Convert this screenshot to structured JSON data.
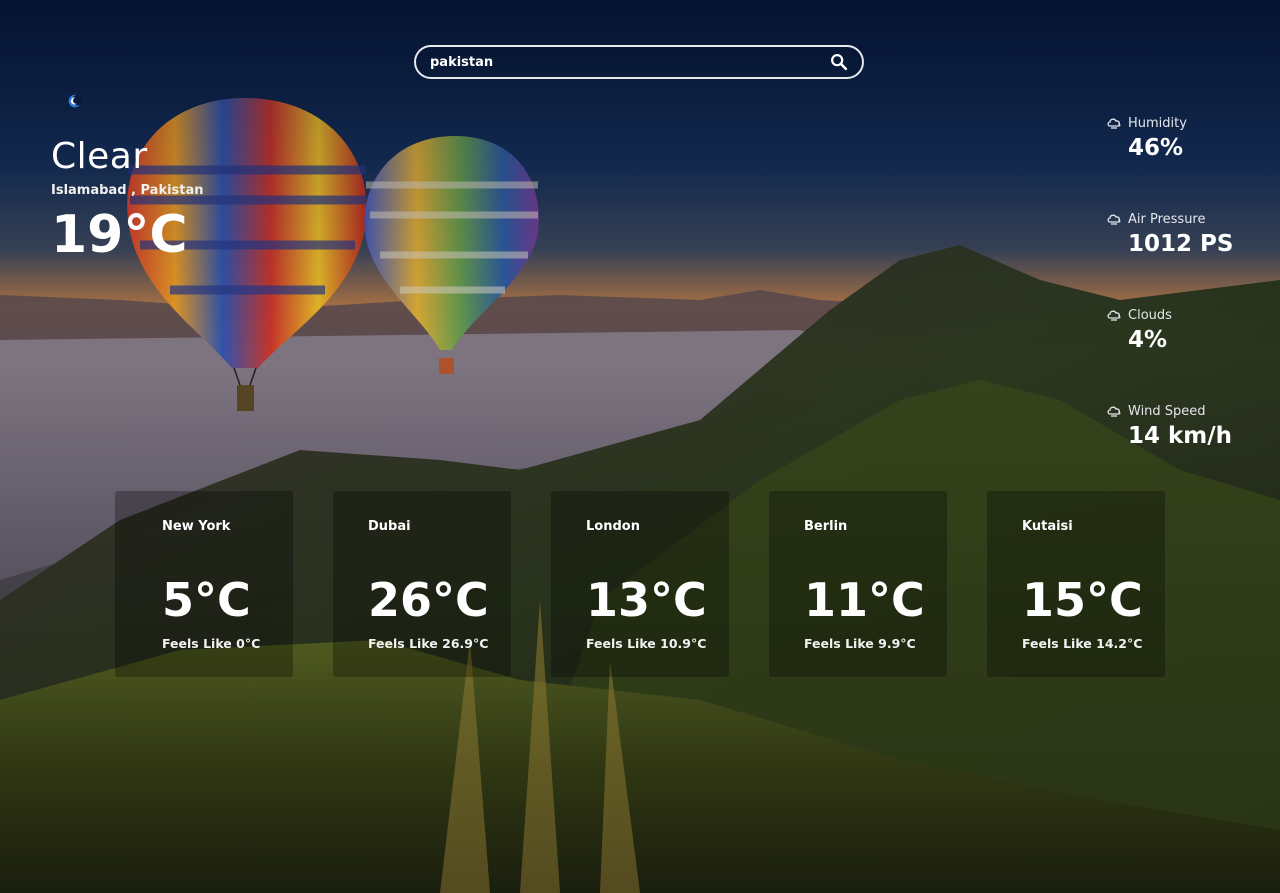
{
  "search": {
    "value": "pakistan"
  },
  "current": {
    "condition": "Clear",
    "location": "Islamabad , Pakistan",
    "temperature": "19°C"
  },
  "stats": [
    {
      "label": "Humidity",
      "value": "46%",
      "icon": "cloud-icon"
    },
    {
      "label": "Air Pressure",
      "value": "1012 PS",
      "icon": "cloud-icon"
    },
    {
      "label": "Clouds",
      "value": "4%",
      "icon": "cloud-icon"
    },
    {
      "label": "Wind Speed",
      "value": "14 km/h",
      "icon": "cloud-icon"
    }
  ],
  "cities": [
    {
      "name": "New York",
      "temp": "5°C",
      "feels": "Feels Like 0°C"
    },
    {
      "name": "Dubai",
      "temp": "26°C",
      "feels": "Feels Like 26.9°C"
    },
    {
      "name": "London",
      "temp": "13°C",
      "feels": "Feels Like 10.9°C"
    },
    {
      "name": "Berlin",
      "temp": "11°C",
      "feels": "Feels Like 9.9°C"
    },
    {
      "name": "Kutaisi",
      "temp": "15°C",
      "feels": "Feels Like 14.2°C"
    }
  ],
  "colors": {
    "sky_top": "#0a1d45",
    "horizon": "#c9884f",
    "hill": "#2b3a1a",
    "grass": "#6b7a2a"
  }
}
